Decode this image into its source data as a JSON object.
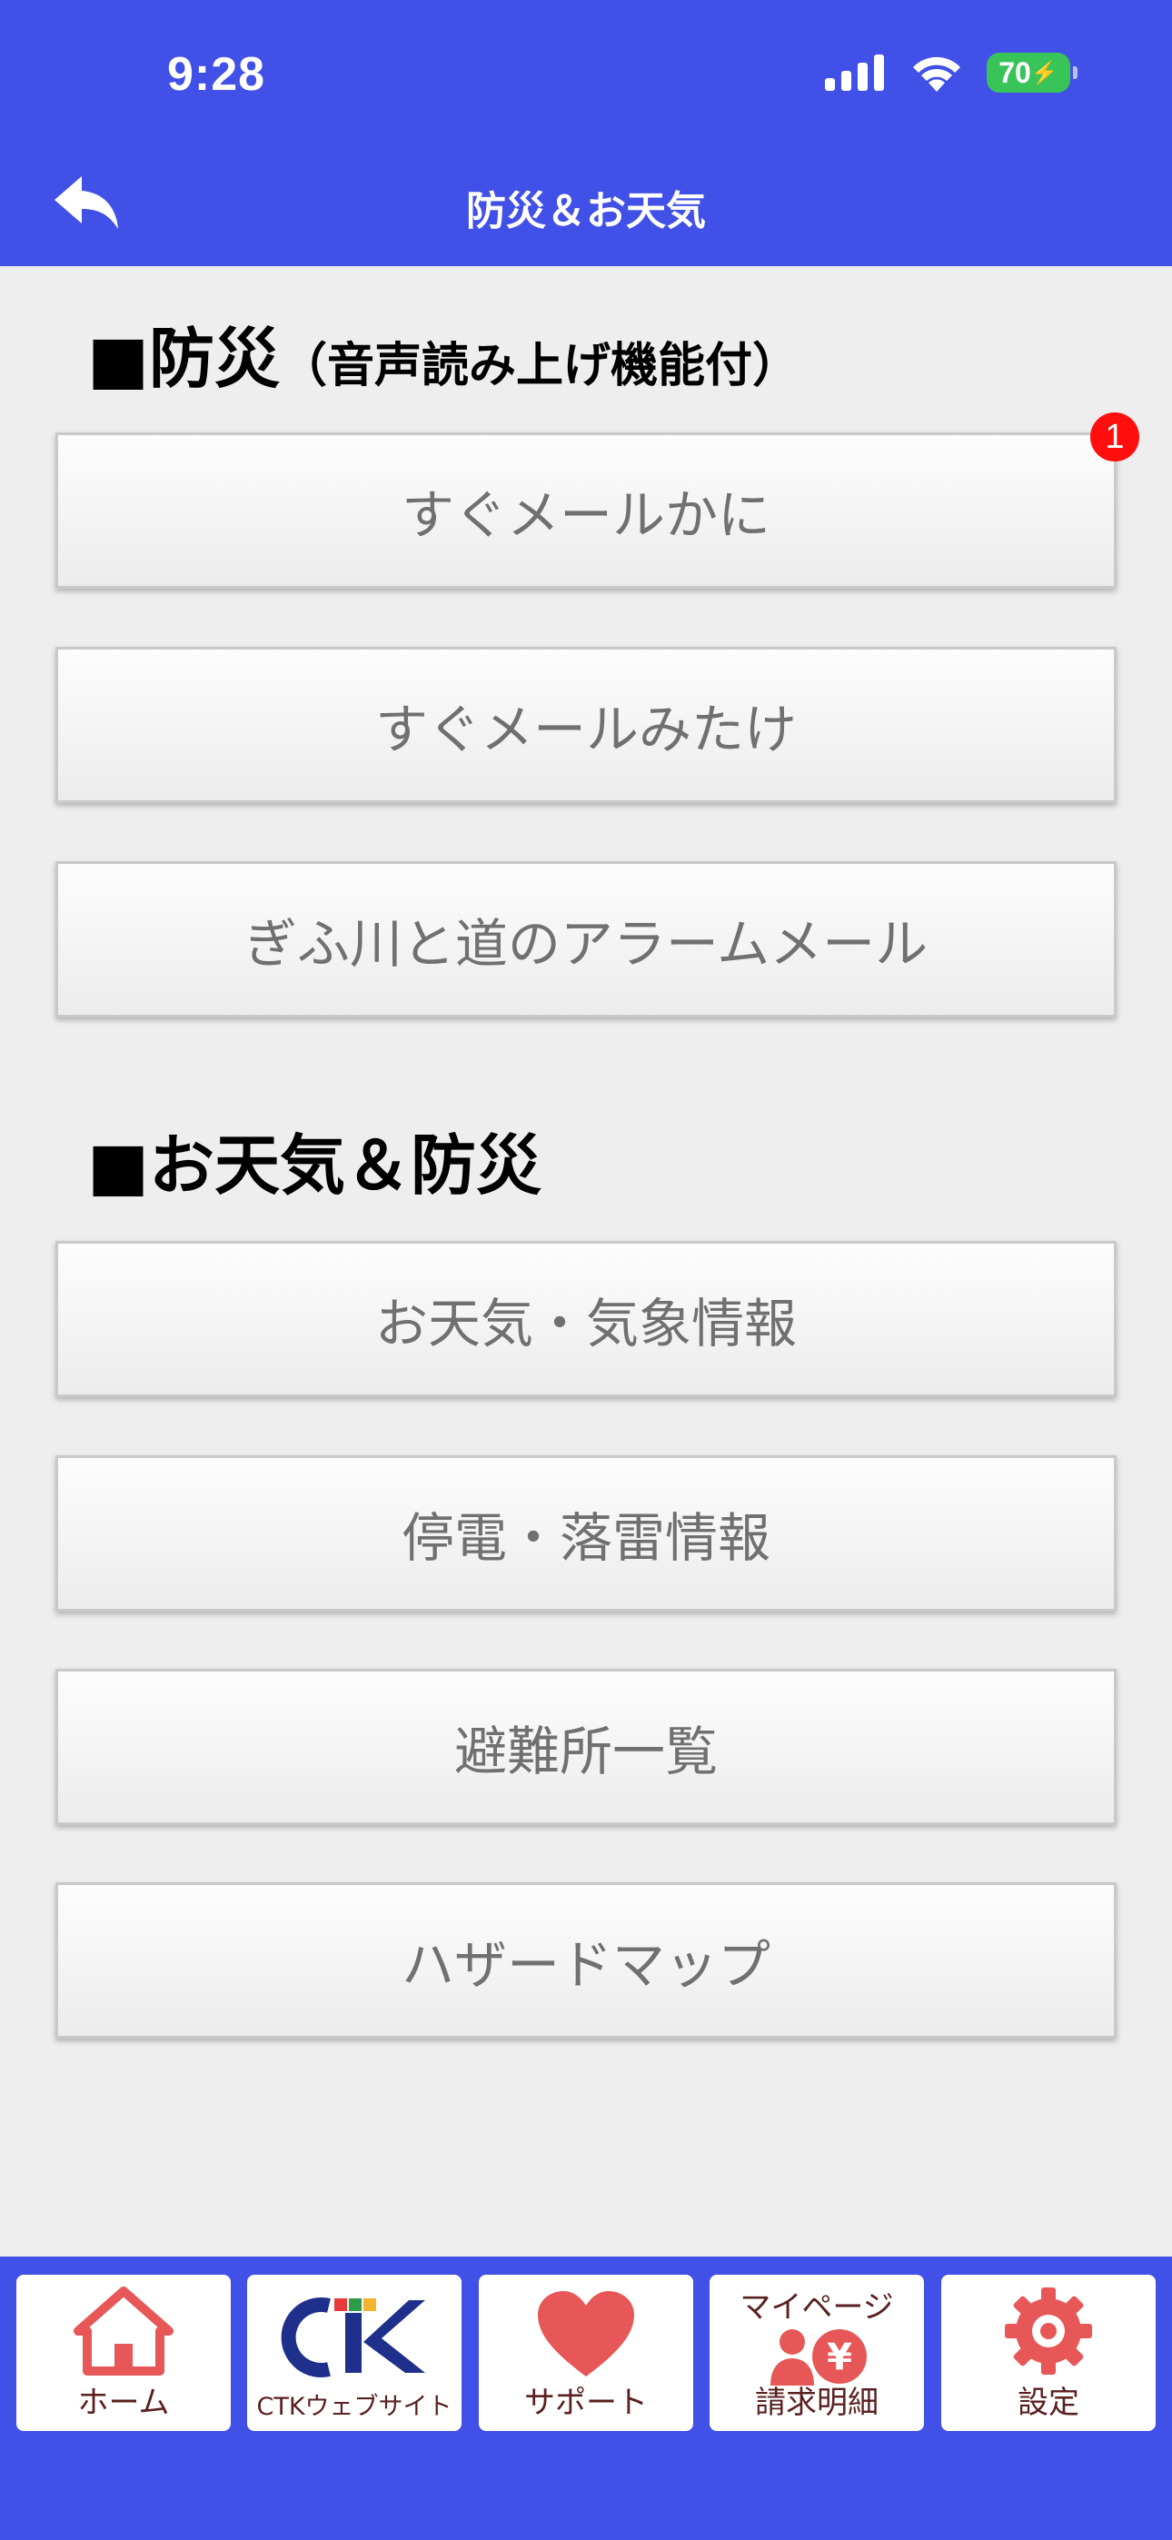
{
  "status_bar": {
    "time": "9:28",
    "battery": "70"
  },
  "header": {
    "title": "防災＆お天気"
  },
  "sections": [
    {
      "title": "■防災",
      "subtitle": "（音声読み上げ機能付）"
    },
    {
      "title": "■お天気＆防災",
      "subtitle": ""
    }
  ],
  "disaster_buttons": [
    "すぐメールかに",
    "すぐメールみたけ",
    "ぎふ川と道のアラームメール"
  ],
  "weather_buttons": [
    "お天気・気象情報",
    "停電・落雷情報",
    "避難所一覧",
    "ハザードマップ"
  ],
  "badge": {
    "count": "1"
  },
  "tabbar": {
    "home": "ホーム",
    "ctk": "CTKウェブサイト",
    "support": "サポート",
    "mypage_top": "マイページ",
    "mypage": "請求明細",
    "settings": "設定"
  },
  "colors": {
    "accent": "#4150e6",
    "tab_icon": "#e85757",
    "badge": "#ff0e0e"
  }
}
